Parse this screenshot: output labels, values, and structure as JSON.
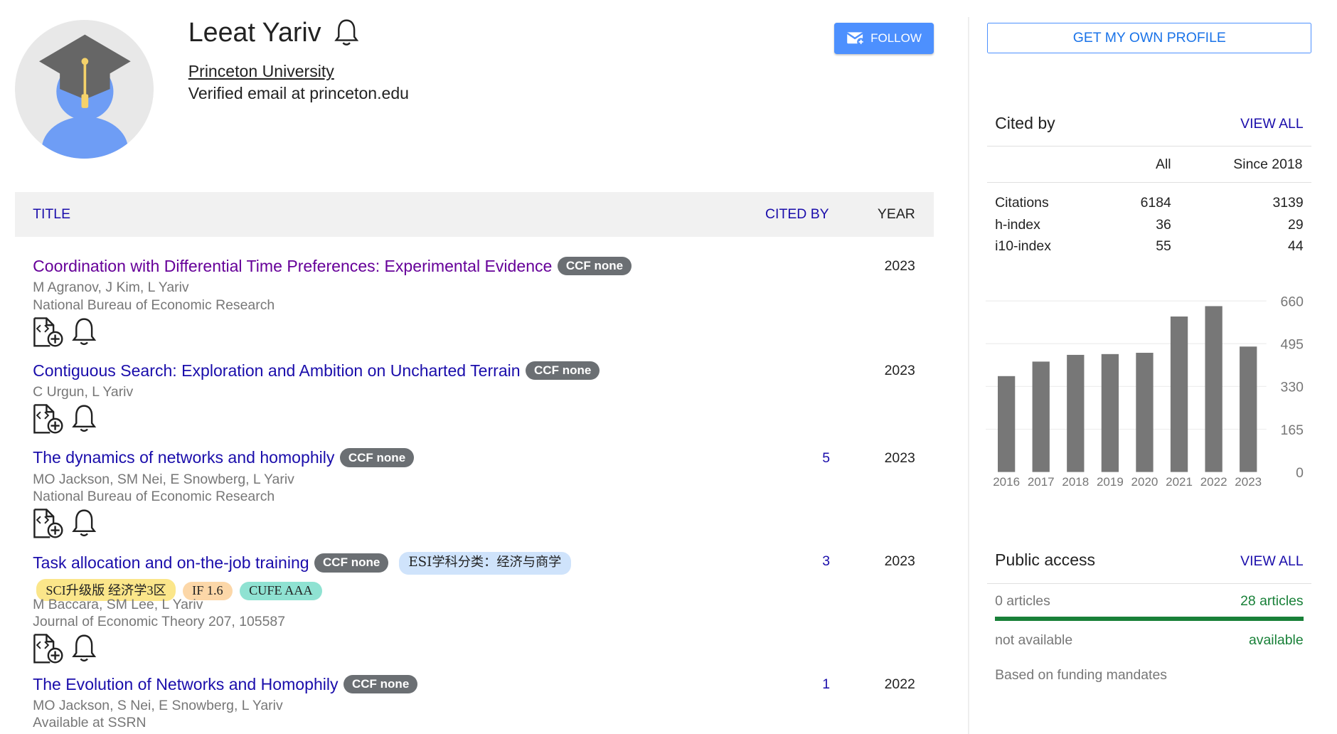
{
  "profile": {
    "name": "Leeat Yariv",
    "affiliation": "Princeton University",
    "email": "Verified email at princeton.edu",
    "follow_label": "FOLLOW"
  },
  "table": {
    "headers": {
      "title": "TITLE",
      "cited_by": "CITED BY",
      "year": "YEAR"
    },
    "articles": [
      {
        "title": "Coordination with Differential Time Preferences: Experimental Evidence",
        "badge": "CCF none",
        "authors": "M Agranov, J Kim, L Yariv",
        "venue": "National Bureau of Economic Research",
        "cited_by": "",
        "year": "2023"
      },
      {
        "title": "Contiguous Search: Exploration and Ambition on Uncharted Terrain",
        "badge": "CCF none",
        "authors": "C Urgun, L Yariv",
        "venue": "",
        "cited_by": "",
        "year": "2023"
      },
      {
        "title": "The dynamics of networks and homophily",
        "badge": "CCF none",
        "authors": "MO Jackson, SM Nei, E Snowberg, L Yariv",
        "venue": "National Bureau of Economic Research",
        "cited_by": "5",
        "year": "2023"
      },
      {
        "title": "Task allocation and on-the-job training",
        "badge": "CCF none",
        "extra_badge": "ESI学科分类：经济与商学",
        "tags": [
          "SCI升级版 经济学3区",
          "IF 1.6",
          "CUFE AAA"
        ],
        "authors": "M Baccara, SM Lee, L Yariv",
        "venue": "Journal of Economic Theory 207, 105587",
        "cited_by": "3",
        "year": "2023"
      },
      {
        "title": "The Evolution of Networks and Homophily",
        "badge": "CCF none",
        "authors": "MO Jackson, S Nei, E Snowberg, L Yariv",
        "venue": "Available at SSRN",
        "cited_by": "1",
        "year": "2022"
      }
    ]
  },
  "sidebar": {
    "get_profile_label": "GET MY OWN PROFILE",
    "cited_by": {
      "title": "Cited by",
      "view_all": "VIEW ALL",
      "col_all": "All",
      "col_since": "Since 2018",
      "rows": [
        {
          "label": "Citations",
          "all": "6184",
          "since": "3139"
        },
        {
          "label": "h-index",
          "all": "36",
          "since": "29"
        },
        {
          "label": "i10-index",
          "all": "55",
          "since": "44"
        }
      ]
    },
    "public_access": {
      "title": "Public access",
      "view_all": "VIEW ALL",
      "left_count": "0 articles",
      "right_count": "28 articles",
      "left_status": "not available",
      "right_status": "available",
      "note": "Based on funding mandates"
    }
  },
  "chart_data": {
    "type": "bar",
    "categories": [
      "2016",
      "2017",
      "2018",
      "2019",
      "2020",
      "2021",
      "2022",
      "2023"
    ],
    "values": [
      370,
      426,
      452,
      455,
      460,
      600,
      640,
      484
    ],
    "ylim": [
      0,
      660
    ],
    "yticks": [
      0,
      165,
      330,
      495,
      660
    ],
    "color": "#777777",
    "grid": true
  }
}
